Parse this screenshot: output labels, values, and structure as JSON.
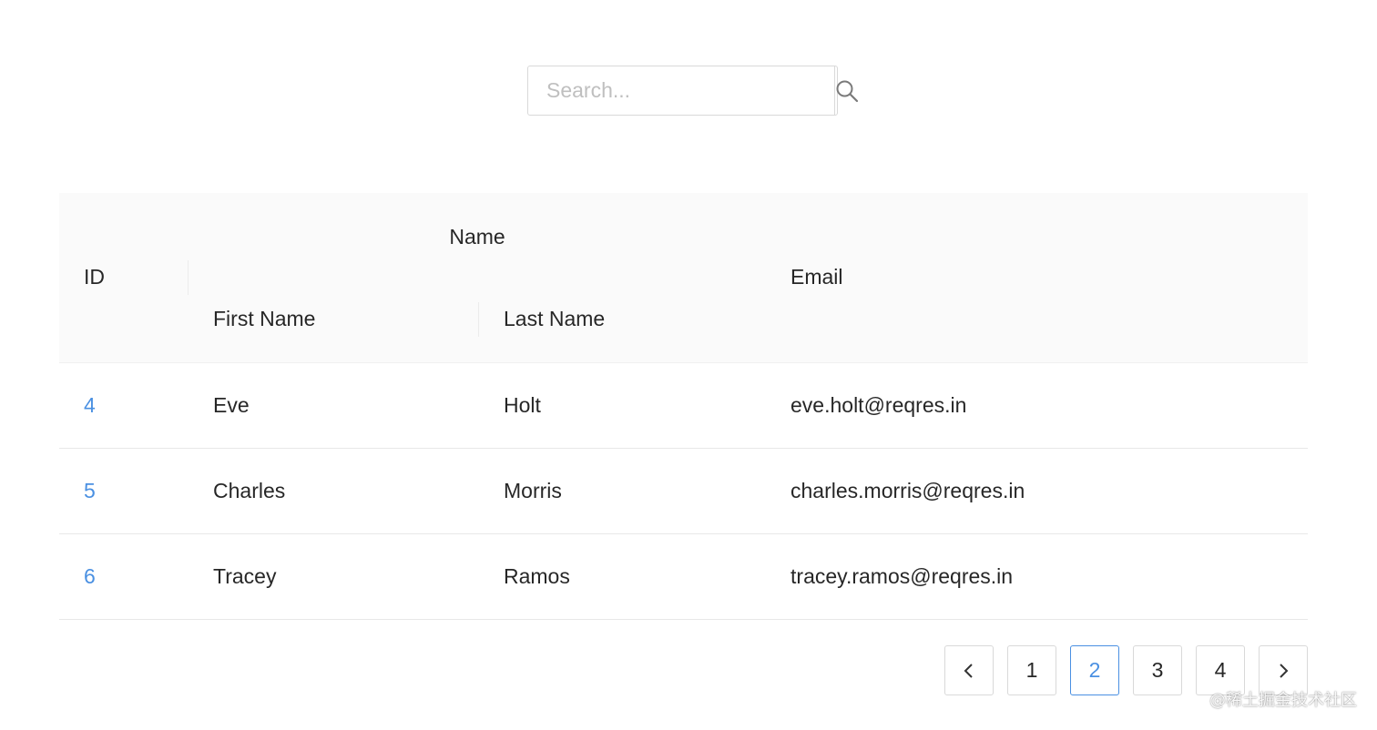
{
  "search": {
    "placeholder": "Search...",
    "value": "",
    "icon": "search-icon"
  },
  "table": {
    "headers": {
      "id": "ID",
      "name_group": "Name",
      "first_name": "First Name",
      "last_name": "Last Name",
      "email": "Email"
    },
    "rows": [
      {
        "id": "4",
        "first_name": "Eve",
        "last_name": "Holt",
        "email": "eve.holt@reqres.in"
      },
      {
        "id": "5",
        "first_name": "Charles",
        "last_name": "Morris",
        "email": "charles.morris@reqres.in"
      },
      {
        "id": "6",
        "first_name": "Tracey",
        "last_name": "Ramos",
        "email": "tracey.ramos@reqres.in"
      }
    ]
  },
  "pagination": {
    "prev_label": "<",
    "next_label": ">",
    "pages": [
      "1",
      "2",
      "3",
      "4"
    ],
    "current": "2"
  },
  "watermark": "@稀土掘金技术社区",
  "colors": {
    "accent": "#4a90e2",
    "header_bg": "#fafafa",
    "border": "#d9d9d9"
  }
}
